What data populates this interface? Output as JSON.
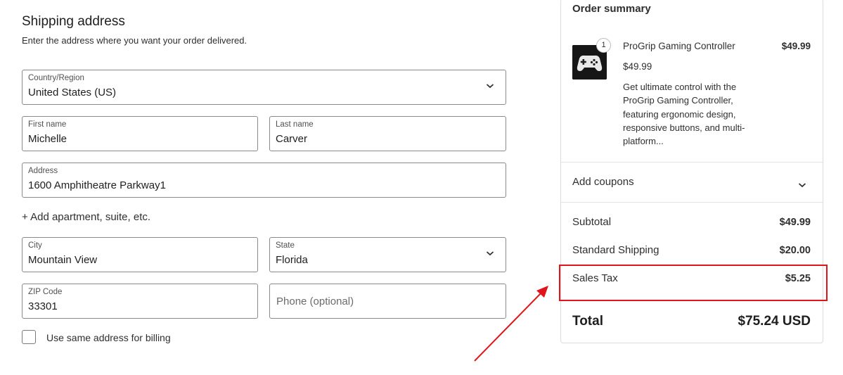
{
  "shipping": {
    "title": "Shipping address",
    "subtitle": "Enter the address where you want your order delivered.",
    "country": {
      "label": "Country/Region",
      "value": "United States (US)"
    },
    "first_name": {
      "label": "First name",
      "value": "Michelle"
    },
    "last_name": {
      "label": "Last name",
      "value": "Carver"
    },
    "address": {
      "label": "Address",
      "value": "1600 Amphitheatre Parkway1"
    },
    "add_apartment": "+ Add apartment, suite, etc.",
    "city": {
      "label": "City",
      "value": "Mountain View"
    },
    "state": {
      "label": "State",
      "value": "Florida"
    },
    "zip": {
      "label": "ZIP Code",
      "value": "33301"
    },
    "phone": {
      "placeholder": "Phone (optional)"
    },
    "billing_checkbox": {
      "label": "Use same address for billing",
      "checked": false
    }
  },
  "summary": {
    "title": "Order summary",
    "product": {
      "quantity": "1",
      "name": "ProGrip Gaming Controller",
      "line_price": "$49.99",
      "unit_price": "$49.99",
      "description": "Get ultimate control with the ProGrip Gaming Controller, featuring ergonomic design, responsive buttons, and multi-platform..."
    },
    "coupons_label": "Add coupons",
    "subtotal": {
      "label": "Subtotal",
      "value": "$49.99"
    },
    "shipping": {
      "label": "Standard Shipping",
      "value": "$20.00"
    },
    "tax": {
      "label": "Sales Tax",
      "value": "$5.25"
    },
    "total": {
      "label": "Total",
      "value": "$75.24 USD"
    }
  },
  "annotation": {
    "highlight_color": "#e0141a"
  },
  "icons": {
    "dropdown": "chevron-down-icon",
    "product": "game-controller-image"
  }
}
